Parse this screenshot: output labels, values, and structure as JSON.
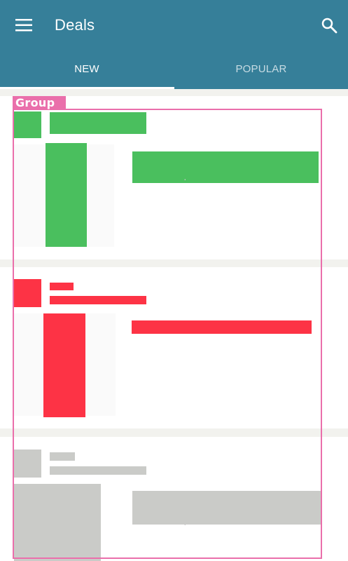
{
  "app_bar": {
    "title": "Deals",
    "menu_icon": "hamburger-menu-icon",
    "search_icon": "search-icon"
  },
  "tabs": [
    {
      "label": "NEW",
      "selected": true
    },
    {
      "label": "POPULAR",
      "selected": false
    }
  ],
  "overlay": {
    "label": "Group",
    "color": "#ea6fab"
  },
  "colors": {
    "app_bar": "#367f99",
    "green": "#4abf5e",
    "red": "#fd3345",
    "gray": "#cacbc8"
  }
}
